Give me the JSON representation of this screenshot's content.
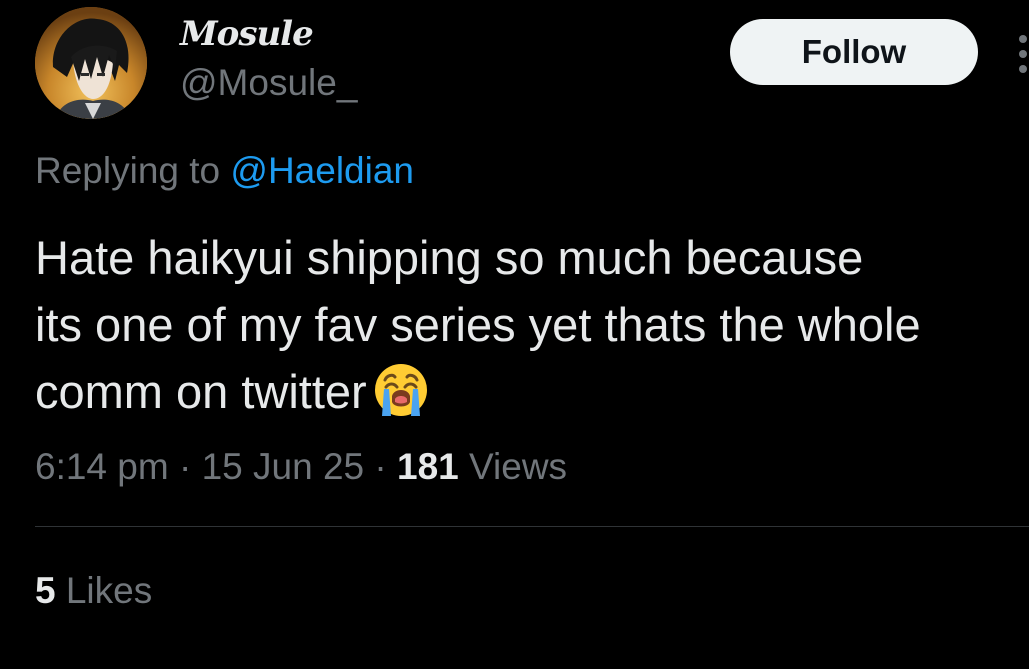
{
  "author": {
    "display_name": "Mosule",
    "handle": "@Mosule_"
  },
  "actions": {
    "follow_label": "Follow",
    "more_icon": "more-vertical-icon"
  },
  "reply": {
    "prefix": "Replying to",
    "mention": "@Haeldian"
  },
  "tweet": {
    "lines": [
      "Hate haikyui shipping so much because",
      "its one of my fav series yet thats the whole",
      "comm on twitter"
    ],
    "emoji": "loudly-crying-face-emoji"
  },
  "meta": {
    "time": "6:14 pm",
    "separator": "·",
    "date": "15 Jun 25",
    "views_count": "181",
    "views_label": "Views"
  },
  "engagement": {
    "likes_count": "5",
    "likes_label": "Likes"
  },
  "colors": {
    "background": "#000000",
    "primary_text": "#e7e9ea",
    "secondary_text": "#71767b",
    "link": "#1d9bf0",
    "follow_bg": "#eff3f4",
    "divider": "#2f3336"
  }
}
